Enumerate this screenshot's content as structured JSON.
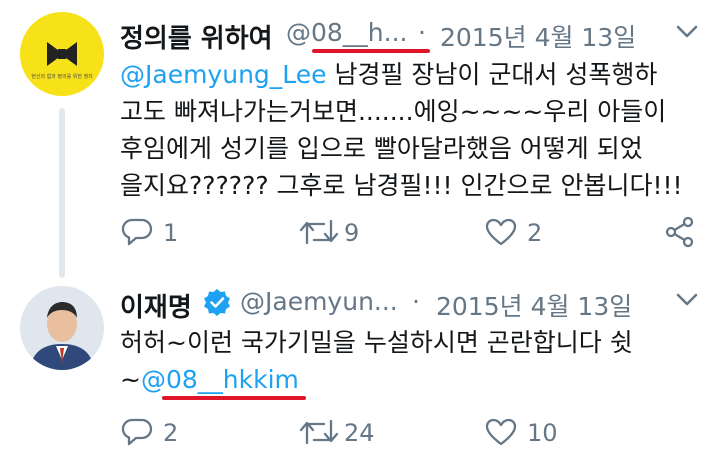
{
  "tweets": [
    {
      "display_name": "정의를 위하여",
      "handle": "@08__h...",
      "separator": "·",
      "date": "2015년 4월 13일",
      "avatar_text": "헌신의 힘과 정의를 위한 정치",
      "body": {
        "mention": "@Jaemyung_Lee",
        "line1_rest": " 남경필 장남이 군대서 성폭행하",
        "line2": "고도 빠져나가는거보면.......에잉~~~~우리 아들이",
        "line3": "후임에게  성기를 입으로 빨아달라했음 어떻게 되었",
        "line4": "을지요?????? 그후로 남경필!!!  인간으로 안봅니다!!!"
      },
      "actions": {
        "reply_count": "1",
        "retweet_count": "9",
        "like_count": "2"
      }
    },
    {
      "display_name": "이재명",
      "verified": true,
      "handle": "@Jaemyun...",
      "separator": "·",
      "date": "2015년 4월 13일",
      "body": {
        "line1": "허허~이런 국가기밀을 누설하시면 곤란합니다 쉿",
        "line2_prefix": "~",
        "mention": "@08__hkkim"
      },
      "actions": {
        "reply_count": "2",
        "retweet_count": "24",
        "like_count": "10"
      }
    }
  ],
  "colors": {
    "link": "#1da1f2",
    "muted": "#657786",
    "annotation_underline": "#e0142a",
    "avatar1_bg": "#f7e21a",
    "verified": "#1da1f2"
  },
  "icons": [
    "reply-icon",
    "retweet-icon",
    "like-icon",
    "share-icon",
    "chevron-down-icon",
    "verified-badge-icon"
  ]
}
